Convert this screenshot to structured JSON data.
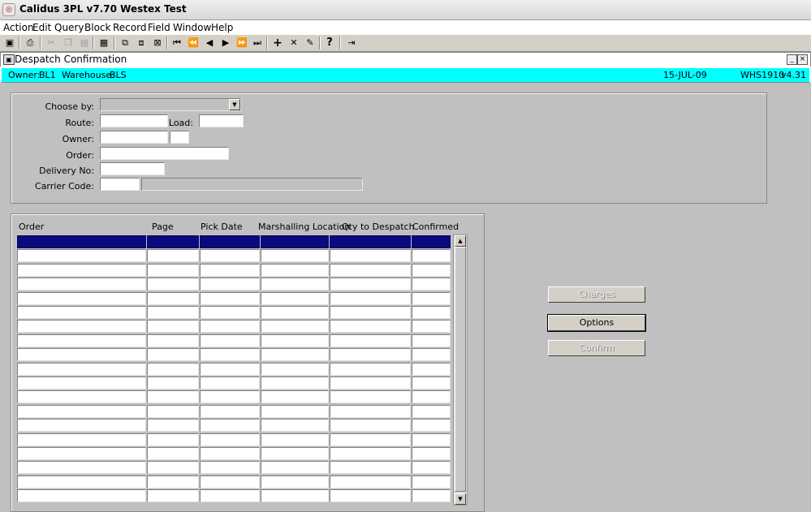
{
  "window": {
    "title": "Calidus 3PL v7.70 Westex Test"
  },
  "menu": [
    "Action",
    "Edit",
    "Query",
    "Block",
    "Record",
    "Field",
    "Window",
    "Help"
  ],
  "toolbar": {
    "icons": [
      "save-icon",
      "print-icon",
      "cut-icon",
      "copy-icon",
      "paste-icon",
      "clear-icon",
      "enter-query-icon",
      "execute-query-icon",
      "cancel-query-icon",
      "first-record-icon",
      "previous-block-icon",
      "previous-record-icon",
      "next-record-icon",
      "next-block-icon",
      "last-record-icon",
      "insert-record-icon",
      "delete-record-icon",
      "edit-icon",
      "help-icon",
      "exit-icon"
    ]
  },
  "form": {
    "title": "Despatch Confirmation",
    "minimize_glyph": "_",
    "close_glyph": "×"
  },
  "info": {
    "owner_label": "Owner:",
    "owner_value": "BL1",
    "warehouse_label": "Warehouse:",
    "warehouse_value": "BLS",
    "date": "15-JUL-09",
    "module": "WHS1910",
    "version": "v4.31"
  },
  "criteria": {
    "choose_by_label": "Choose by:",
    "choose_by_value": "",
    "route_label": "Route:",
    "route_value": "",
    "load_label": "Load:",
    "load_value": "",
    "owner_label": "Owner:",
    "owner_value": "",
    "owner_sub_value": "",
    "order_label": "Order:",
    "order_value": "",
    "delivery_label": "Delivery No:",
    "delivery_value": "",
    "carrier_label": "Carrier Code:",
    "carrier_value": "",
    "carrier_desc": ""
  },
  "grid": {
    "columns": [
      "Order",
      "Page",
      "Pick Date",
      "Marshalling Location",
      "Qty to Despatch",
      "Confirmed"
    ],
    "row_count": 19,
    "selected_row": 0
  },
  "buttons": {
    "charges": "Charges",
    "options": "Options",
    "confirm": "Confirm"
  }
}
